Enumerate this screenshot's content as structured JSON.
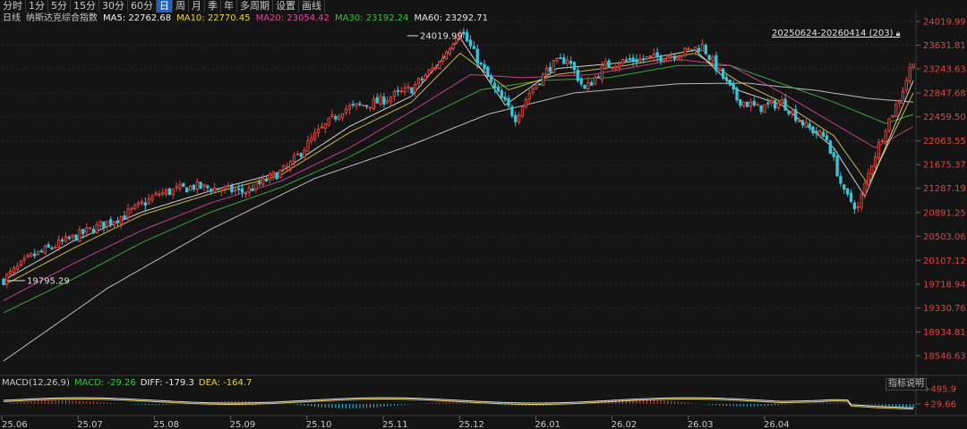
{
  "toolbar": {
    "tabs": [
      {
        "label": "分时",
        "active": false
      },
      {
        "label": "1分",
        "active": false
      },
      {
        "label": "5分",
        "active": false
      },
      {
        "label": "15分",
        "active": false
      },
      {
        "label": "30分",
        "active": false
      },
      {
        "label": "60分",
        "active": false
      },
      {
        "label": "日",
        "active": true
      },
      {
        "label": "周",
        "active": false
      },
      {
        "label": "月",
        "active": false
      },
      {
        "label": "季",
        "active": false
      },
      {
        "label": "年",
        "active": false
      },
      {
        "label": "多周期",
        "active": false
      },
      {
        "label": "设置",
        "active": false
      },
      {
        "label": "画线",
        "active": false
      }
    ]
  },
  "legend": {
    "period": "日线",
    "name": "纳斯达克综合指数",
    "ma5": "MA5: 22762.68",
    "ma10": "MA10: 22770.45",
    "ma20": "MA20: 23054.42",
    "ma30": "MA30: 23192.24",
    "ma60": "MA60: 23292.71"
  },
  "colors": {
    "up": "#e0443e",
    "down": "#3cc3d8",
    "ma5": "#f2f2f2",
    "ma10": "#e8d34a",
    "ma20": "#e0489c",
    "ma30": "#3fbf3f",
    "ma60": "#d8d8d8",
    "grid": "#2a2a2a"
  },
  "range_label": "20250624-20260414 (203)",
  "macd": {
    "title": "MACD(12,26,9)",
    "macd": "MACD: -29.26",
    "diff": "DIFF: -179.3",
    "dea": "DEA: -164.7",
    "ticks": [
      "+495.9",
      "+29.66"
    ],
    "indicator_button": "指标说明"
  },
  "chart_data": {
    "type": "candlestick",
    "y_ticks": [
      "24019.99",
      "23631.81",
      "23243.63",
      "22847.68",
      "22459.50",
      "22063.55",
      "21675.37",
      "21287.19",
      "20891.25",
      "20503.06",
      "20107.12",
      "19718.94",
      "19330.76",
      "18934.81",
      "18546.63"
    ],
    "ylim": [
      18546.63,
      24019.99
    ],
    "x_ticks": [
      "25.06",
      "25.07",
      "25.08",
      "25.09",
      "25.10",
      "25.11",
      "25.12",
      "26.01",
      "26.02",
      "26.03",
      "26.04"
    ],
    "annotations": {
      "high": "24019.99",
      "low": "19795.29"
    },
    "price_anchors": [
      [
        0,
        19795
      ],
      [
        8,
        20170
      ],
      [
        20,
        20480
      ],
      [
        35,
        20850
      ],
      [
        45,
        21200
      ],
      [
        55,
        21320
      ],
      [
        70,
        21230
      ],
      [
        82,
        21620
      ],
      [
        90,
        22150
      ],
      [
        98,
        22580
      ],
      [
        108,
        22700
      ],
      [
        118,
        22920
      ],
      [
        126,
        23350
      ],
      [
        132,
        23900
      ],
      [
        135,
        23600
      ],
      [
        142,
        22900
      ],
      [
        148,
        22450
      ],
      [
        152,
        22850
      ],
      [
        158,
        23280
      ],
      [
        163,
        23420
      ],
      [
        168,
        22900
      ],
      [
        174,
        23300
      ],
      [
        180,
        23380
      ],
      [
        188,
        23420
      ],
      [
        196,
        23500
      ],
      [
        202,
        23620
      ],
      [
        208,
        23100
      ],
      [
        212,
        22750
      ],
      [
        218,
        22600
      ],
      [
        225,
        22700
      ],
      [
        232,
        22300
      ],
      [
        238,
        22100
      ],
      [
        243,
        21200
      ],
      [
        247,
        20960
      ],
      [
        251,
        21700
      ],
      [
        255,
        22300
      ],
      [
        259,
        22750
      ],
      [
        263,
        23400
      ]
    ],
    "ma60_anchors": [
      [
        0,
        18460
      ],
      [
        30,
        19650
      ],
      [
        60,
        20620
      ],
      [
        90,
        21450
      ],
      [
        118,
        22000
      ],
      [
        140,
        22500
      ],
      [
        165,
        22850
      ],
      [
        195,
        23000
      ],
      [
        215,
        23010
      ],
      [
        235,
        22890
      ],
      [
        250,
        22760
      ],
      [
        263,
        22700
      ]
    ],
    "ma30_anchors": [
      [
        0,
        19250
      ],
      [
        20,
        19800
      ],
      [
        40,
        20400
      ],
      [
        60,
        20900
      ],
      [
        80,
        21300
      ],
      [
        100,
        21800
      ],
      [
        120,
        22400
      ],
      [
        138,
        22900
      ],
      [
        155,
        23050
      ],
      [
        175,
        23100
      ],
      [
        195,
        23300
      ],
      [
        210,
        23300
      ],
      [
        225,
        23000
      ],
      [
        240,
        22700
      ],
      [
        255,
        22350
      ],
      [
        263,
        22500
      ]
    ],
    "ma20_anchors": [
      [
        0,
        19450
      ],
      [
        20,
        20050
      ],
      [
        40,
        20600
      ],
      [
        60,
        21050
      ],
      [
        80,
        21400
      ],
      [
        100,
        21950
      ],
      [
        118,
        22550
      ],
      [
        135,
        23150
      ],
      [
        150,
        23100
      ],
      [
        170,
        23150
      ],
      [
        195,
        23400
      ],
      [
        210,
        23300
      ],
      [
        225,
        22850
      ],
      [
        240,
        22350
      ],
      [
        252,
        21950
      ],
      [
        263,
        22300
      ]
    ],
    "ma10_anchors": [
      [
        0,
        19700
      ],
      [
        20,
        20300
      ],
      [
        40,
        20850
      ],
      [
        60,
        21200
      ],
      [
        80,
        21500
      ],
      [
        100,
        22200
      ],
      [
        118,
        22700
      ],
      [
        132,
        23500
      ],
      [
        146,
        22900
      ],
      [
        160,
        23150
      ],
      [
        180,
        23300
      ],
      [
        200,
        23500
      ],
      [
        212,
        23050
      ],
      [
        225,
        22700
      ],
      [
        240,
        22150
      ],
      [
        250,
        21350
      ],
      [
        263,
        22850
      ]
    ],
    "ma5_anchors": [
      [
        0,
        19780
      ],
      [
        20,
        20420
      ],
      [
        40,
        20900
      ],
      [
        60,
        21250
      ],
      [
        80,
        21550
      ],
      [
        100,
        22300
      ],
      [
        118,
        22800
      ],
      [
        132,
        23750
      ],
      [
        145,
        22650
      ],
      [
        160,
        23250
      ],
      [
        180,
        23350
      ],
      [
        200,
        23550
      ],
      [
        212,
        22900
      ],
      [
        225,
        22650
      ],
      [
        240,
        21950
      ],
      [
        249,
        21150
      ],
      [
        263,
        23050
      ]
    ]
  }
}
